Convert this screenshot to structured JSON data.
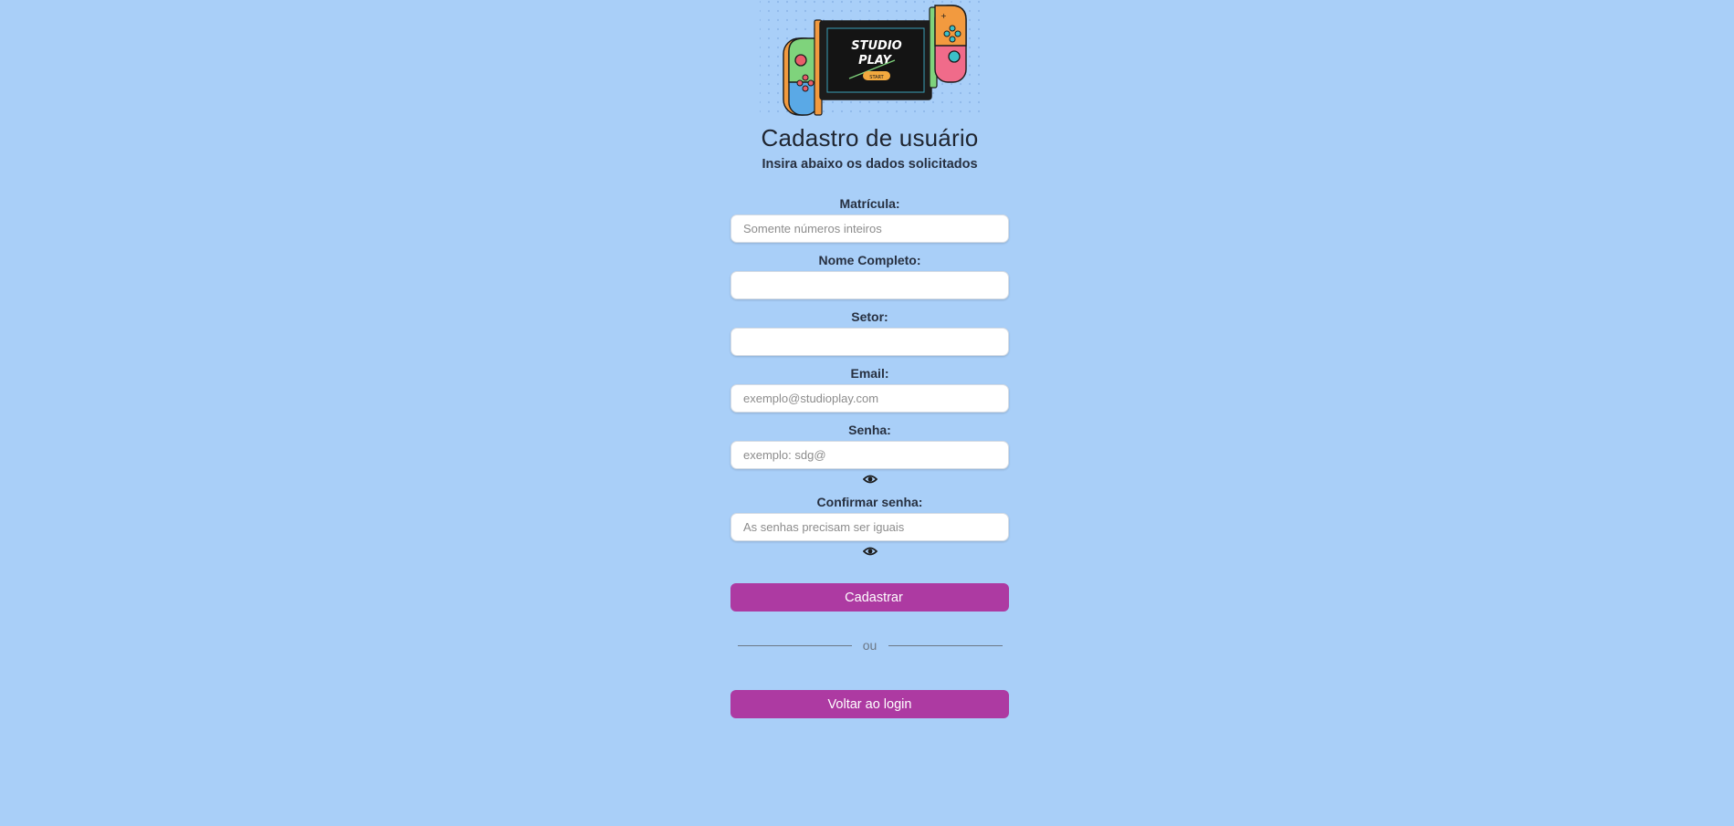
{
  "logo": {
    "line1": "STUDIO",
    "line2": "PLAY",
    "start": "START"
  },
  "header": {
    "title": "Cadastro de usuário",
    "subtitle": "Insira abaixo os dados solicitados"
  },
  "form": {
    "matricula": {
      "label": "Matrícula:",
      "placeholder": "Somente números inteiros",
      "value": ""
    },
    "nome": {
      "label": "Nome Completo:",
      "placeholder": "",
      "value": ""
    },
    "setor": {
      "label": "Setor:",
      "placeholder": "",
      "value": ""
    },
    "email": {
      "label": "Email:",
      "placeholder": "exemplo@studioplay.com",
      "value": ""
    },
    "senha": {
      "label": "Senha:",
      "placeholder": "exemplo: sdg@",
      "value": "",
      "toggle_icon": "eye-icon"
    },
    "confirmar": {
      "label": "Confirmar senha:",
      "placeholder": "As senhas precisam ser iguais",
      "value": "",
      "toggle_icon": "eye-icon"
    }
  },
  "actions": {
    "register_label": "Cadastrar",
    "divider_label": "ou",
    "back_label": "Voltar ao login"
  },
  "colors": {
    "background": "#a9cff8",
    "button": "#ad3aa2",
    "text": "#1f2530"
  }
}
